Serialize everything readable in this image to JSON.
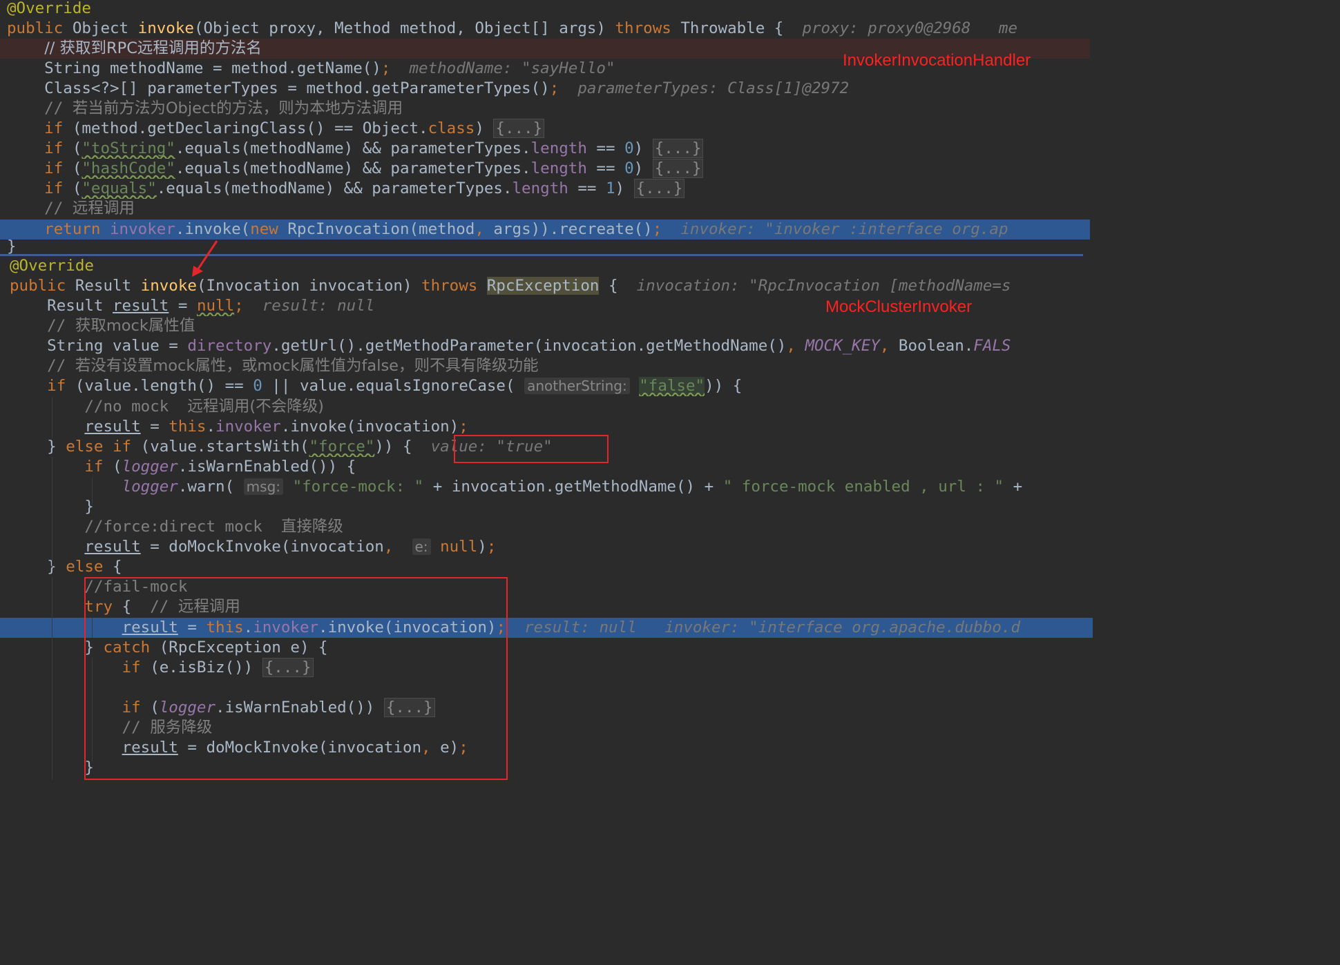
{
  "labels": {
    "handler": "InvokerInvocationHandler",
    "cluster": "MockClusterInvoker"
  },
  "lines": [
    [
      [
        "ann",
        "@Override"
      ]
    ],
    [
      [
        "kw",
        "public "
      ],
      [
        "",
        "Object "
      ],
      [
        "fn",
        "invoke"
      ],
      [
        "",
        "(Object proxy, Method method, Object[] args) "
      ],
      [
        "kw",
        "throws "
      ],
      [
        "",
        "Throwable {  "
      ],
      [
        "hint",
        "proxy: proxy0@2968   me"
      ]
    ],
    [
      [
        "",
        "    "
      ],
      [
        "cn",
        "// 获取到RPC远程调用的方法名"
      ]
    ],
    [
      [
        "",
        "    String methodName = method.getName()"
      ],
      [
        "kw",
        ";"
      ],
      [
        "hint",
        "  methodName: \"sayHello\""
      ]
    ],
    [
      [
        "",
        "    Class<?>[] parameterTypes = method.getParameterTypes()"
      ],
      [
        "kw",
        ";"
      ],
      [
        "hint",
        "  parameterTypes: Class[1]@2972"
      ]
    ],
    [
      [
        "cmt",
        "    // "
      ],
      [
        "cmt cn",
        "若当前方法为Object的方法，则为本地方法调用"
      ]
    ],
    [
      [
        "kw",
        "    if "
      ],
      [
        "",
        "(method.getDeclaringClass() == Object."
      ],
      [
        "kw",
        "class"
      ],
      [
        "",
        ") "
      ],
      [
        "fold",
        "{...}"
      ]
    ],
    [
      [
        "kw",
        "    if "
      ],
      [
        "",
        "("
      ],
      [
        "str wavy",
        "\"toString\""
      ],
      [
        "",
        ".equals(methodName) && parameterTypes."
      ],
      [
        "fld",
        "length"
      ],
      [
        "",
        " == "
      ],
      [
        "num",
        "0"
      ],
      [
        "",
        ") "
      ],
      [
        "fold",
        "{...}"
      ]
    ],
    [
      [
        "kw",
        "    if "
      ],
      [
        "",
        "("
      ],
      [
        "str wavy",
        "\"hashCode\""
      ],
      [
        "",
        ".equals(methodName) && parameterTypes."
      ],
      [
        "fld",
        "length"
      ],
      [
        "",
        " == "
      ],
      [
        "num",
        "0"
      ],
      [
        "",
        ") "
      ],
      [
        "fold",
        "{...}"
      ]
    ],
    [
      [
        "kw",
        "    if "
      ],
      [
        "",
        "("
      ],
      [
        "str wavy",
        "\"equals\""
      ],
      [
        "",
        ".equals(methodName) && parameterTypes."
      ],
      [
        "fld",
        "length"
      ],
      [
        "",
        " == "
      ],
      [
        "num",
        "1"
      ],
      [
        "",
        ") "
      ],
      [
        "fold",
        "{...}"
      ]
    ],
    [
      [
        "cmt",
        "    // "
      ],
      [
        "cmt cn",
        "远程调用"
      ]
    ],
    [
      [
        "kw",
        "    return "
      ],
      [
        "fld",
        "invoker"
      ],
      [
        "",
        ".invoke("
      ],
      [
        "kw",
        "new "
      ],
      [
        "",
        "RpcInvocation(method"
      ],
      [
        "kw",
        ","
      ],
      [
        "",
        " args)).recreate()"
      ],
      [
        "kw",
        ";"
      ],
      [
        "hint",
        "  invoker: \"invoker :interface org.ap"
      ]
    ],
    [
      [
        "",
        "}"
      ]
    ],
    [
      [
        "ann",
        "@Override"
      ]
    ],
    [
      [
        "kw",
        "public "
      ],
      [
        "",
        "Result "
      ],
      [
        "fn",
        "invoke"
      ],
      [
        "",
        "(Invocation invocation) "
      ],
      [
        "kw",
        "throws "
      ],
      [
        "excp",
        "RpcException"
      ],
      [
        "",
        " {  "
      ],
      [
        "hint",
        "invocation: \"RpcInvocation [methodName=s"
      ]
    ],
    [
      [
        "",
        "    Result "
      ],
      [
        "ul",
        "result"
      ],
      [
        "",
        " = "
      ],
      [
        "kw wavy",
        "null"
      ],
      [
        "kw",
        ";"
      ],
      [
        "hint",
        "  result: null"
      ]
    ],
    [
      [
        "cmt",
        "    // "
      ],
      [
        "cmt cn",
        "获取mock属性值"
      ]
    ],
    [
      [
        "",
        "    String value = "
      ],
      [
        "fld",
        "directory"
      ],
      [
        "",
        ".getUrl().getMethodParameter(invocation.getMethodName()"
      ],
      [
        "kw",
        ","
      ],
      [
        "",
        " "
      ],
      [
        "ifield",
        "MOCK_KEY"
      ],
      [
        "kw",
        ","
      ],
      [
        "",
        " Boolean."
      ],
      [
        "ifield",
        "FALS"
      ]
    ],
    [
      [
        "cmt",
        "    // "
      ],
      [
        "cmt cn",
        "若没有设置mock属性，或mock属性值为false，则不具有降级功能"
      ]
    ],
    [
      [
        "kw",
        "    if "
      ],
      [
        "",
        "(value.length() == "
      ],
      [
        "num",
        "0"
      ],
      [
        "",
        " || value.equalsIgnoreCase( "
      ],
      [
        "ph",
        "anotherString:"
      ],
      [
        "",
        " "
      ],
      [
        "str wavy hlw",
        "\"false\""
      ],
      [
        "",
        ")) {"
      ]
    ],
    [
      [
        "cmt",
        "        //no mock  "
      ],
      [
        "cmt cn",
        "远程调用(不会降级)"
      ]
    ],
    [
      [
        "",
        "        "
      ],
      [
        "ul",
        "result"
      ],
      [
        "",
        " = "
      ],
      [
        "kw",
        "this"
      ],
      [
        "",
        "."
      ],
      [
        "fld",
        "invoker"
      ],
      [
        "",
        ".invoke(invocation)"
      ],
      [
        "kw",
        ";"
      ]
    ],
    [
      [
        "",
        "    } "
      ],
      [
        "kw",
        "else if "
      ],
      [
        "",
        "(value.startsWith("
      ],
      [
        "str wavy",
        "\"force\""
      ],
      [
        "",
        ")) {  "
      ],
      [
        "hint",
        "value: \"true\""
      ]
    ],
    [
      [
        "kw",
        "        if "
      ],
      [
        "",
        "("
      ],
      [
        "ifield",
        "logger"
      ],
      [
        "",
        ".isWarnEnabled()) {"
      ]
    ],
    [
      [
        "",
        "            "
      ],
      [
        "ifield",
        "logger"
      ],
      [
        "",
        ".warn( "
      ],
      [
        "ph",
        "msg:"
      ],
      [
        "",
        " "
      ],
      [
        "str",
        "\"force-mock: \""
      ],
      [
        "",
        " + invocation.getMethodName() + "
      ],
      [
        "str",
        "\" force-mock enabled , url : \""
      ],
      [
        "",
        " +"
      ]
    ],
    [
      [
        "",
        "        }"
      ]
    ],
    [
      [
        "cmt",
        "        //force:direct mock  "
      ],
      [
        "cmt cn",
        "直接降级"
      ]
    ],
    [
      [
        "",
        "        "
      ],
      [
        "ul",
        "result"
      ],
      [
        "",
        " = doMockInvoke(invocation"
      ],
      [
        "kw",
        ","
      ],
      [
        "",
        "  "
      ],
      [
        "ph",
        "e:"
      ],
      [
        "",
        " "
      ],
      [
        "kw",
        "null"
      ],
      [
        "",
        ")"
      ],
      [
        "kw",
        ";"
      ]
    ],
    [
      [
        "",
        "    } "
      ],
      [
        "kw",
        "else "
      ],
      [
        "",
        "{"
      ]
    ],
    [
      [
        "cmt",
        "        //fail-mock"
      ]
    ],
    [
      [
        "kw",
        "        try "
      ],
      [
        "",
        "{  "
      ],
      [
        "cmt",
        "// "
      ],
      [
        "cmt cn",
        "远程调用"
      ]
    ],
    [
      [
        "",
        "            "
      ],
      [
        "ul",
        "result"
      ],
      [
        "",
        " = "
      ],
      [
        "kw",
        "this"
      ],
      [
        "",
        "."
      ],
      [
        "fld",
        "invoker"
      ],
      [
        "",
        ".invoke(invocation)"
      ],
      [
        "kw",
        ";"
      ],
      [
        "hint",
        "  result: null   invoker: \"interface org.apache.dubbo.d"
      ]
    ],
    [
      [
        "",
        "        } "
      ],
      [
        "kw",
        "catch "
      ],
      [
        "",
        "(RpcException e) {"
      ]
    ],
    [
      [
        "kw",
        "            if "
      ],
      [
        "",
        "(e.isBiz()) "
      ],
      [
        "fold",
        "{...}"
      ]
    ],
    [
      [
        "",
        ""
      ]
    ],
    [
      [
        "kw",
        "            if "
      ],
      [
        "",
        "("
      ],
      [
        "ifield",
        "logger"
      ],
      [
        "",
        ".isWarnEnabled()) "
      ],
      [
        "fold",
        "{...}"
      ]
    ],
    [
      [
        "cmt",
        "            // "
      ],
      [
        "cmt cn",
        "服务降级"
      ]
    ],
    [
      [
        "",
        "            "
      ],
      [
        "ul",
        "result"
      ],
      [
        "",
        " = doMockInvoke(invocation"
      ],
      [
        "kw",
        ","
      ],
      [
        "",
        " e)"
      ],
      [
        "kw",
        ";"
      ]
    ],
    [
      [
        "",
        "        }"
      ]
    ]
  ]
}
